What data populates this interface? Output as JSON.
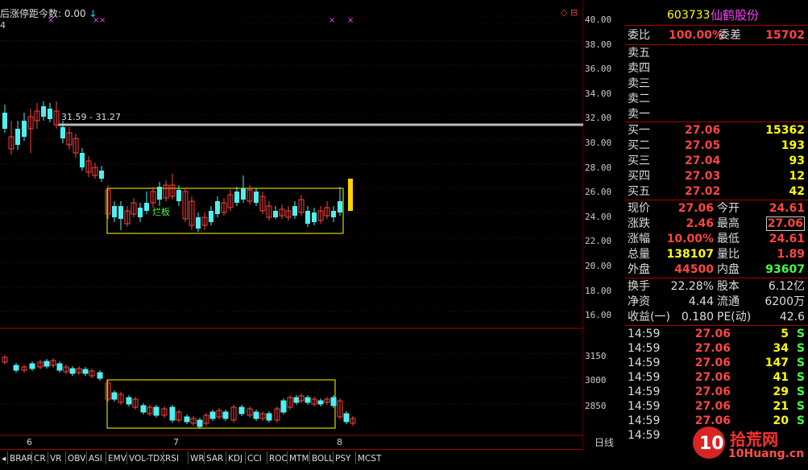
{
  "indicator": {
    "title": "后涨停距今数:",
    "value": "0.00",
    "arrow": "↓",
    "sub": "4"
  },
  "price_axis": [
    "40.00",
    "38.00",
    "36.00",
    "34.00",
    "32.00",
    "30.00",
    "28.00",
    "26.00",
    "24.00",
    "22.00",
    "20.00",
    "18.00",
    "16.00"
  ],
  "index_axis": [
    "3150",
    "3000",
    "2850"
  ],
  "x_axis": {
    "labels": [
      "6",
      "7",
      "8"
    ],
    "period": "日线"
  },
  "annotations": {
    "range_text": "31.59 - 31.27",
    "box_label": "烂板",
    "corner_icons": "◇ ⊟"
  },
  "tabs": [
    "BRAR",
    "CR",
    "VR",
    "OBV",
    "ASI",
    "EMV",
    "VOL-TDX",
    "RSI",
    "WR",
    "SAR",
    "KDJ",
    "CCI",
    "ROC",
    "MTM",
    "BOLL",
    "PSY",
    "MCST"
  ],
  "panel": {
    "code": "603733",
    "name": "仙鹤股份",
    "weibi_label": "委比",
    "weibi_value": "100.00%",
    "weicha_label": "委差",
    "weicha_value": "15702",
    "sell": [
      {
        "label": "卖五"
      },
      {
        "label": "卖四"
      },
      {
        "label": "卖三"
      },
      {
        "label": "卖二"
      },
      {
        "label": "卖一"
      }
    ],
    "buy": [
      {
        "label": "买一",
        "price": "27.06",
        "vol": "15362"
      },
      {
        "label": "买二",
        "price": "27.05",
        "vol": "193"
      },
      {
        "label": "买三",
        "price": "27.04",
        "vol": "93"
      },
      {
        "label": "买四",
        "price": "27.03",
        "vol": "12"
      },
      {
        "label": "买五",
        "price": "27.02",
        "vol": "42"
      }
    ],
    "quote": [
      {
        "l1": "现价",
        "v1": "27.06",
        "l2": "今开",
        "v2": "24.61",
        "c1": "red",
        "c2": "red"
      },
      {
        "l1": "涨跌",
        "v1": "2.46",
        "l2": "最高",
        "v2": "27.06",
        "c1": "red",
        "c2": "red"
      },
      {
        "l1": "涨幅",
        "v1": "10.00%",
        "l2": "最低",
        "v2": "24.61",
        "c1": "red",
        "c2": "red"
      },
      {
        "l1": "总量",
        "v1": "138107",
        "l2": "量比",
        "v2": "1.89",
        "c1": "yellow",
        "c2": "red"
      },
      {
        "l1": "外盘",
        "v1": "44500",
        "l2": "内盘",
        "v2": "93607",
        "c1": "red",
        "c2": "green"
      }
    ],
    "fund": [
      {
        "l1": "换手",
        "v1": "22.28%",
        "l2": "股本",
        "v2": "6.12亿"
      },
      {
        "l1": "净资",
        "v1": "4.44",
        "l2": "流通",
        "v2": "6200万"
      },
      {
        "l1": "收益(一)",
        "v1": "0.180",
        "l2": "PE(动)",
        "v2": "42.6"
      }
    ],
    "ticks": [
      {
        "time": "14:59",
        "price": "27.06",
        "vol": "5",
        "side": "S"
      },
      {
        "time": "14:59",
        "price": "27.06",
        "vol": "34",
        "side": "S"
      },
      {
        "time": "14:59",
        "price": "27.06",
        "vol": "147",
        "side": "S"
      },
      {
        "time": "14:59",
        "price": "27.06",
        "vol": "41",
        "side": "S"
      },
      {
        "time": "14:59",
        "price": "27.06",
        "vol": "29",
        "side": "S"
      },
      {
        "time": "14:59",
        "price": "27.06",
        "vol": "21",
        "side": "S"
      },
      {
        "time": "14:59",
        "price": "27.06",
        "vol": "20",
        "side": "S"
      },
      {
        "time": "14:59",
        "price": "",
        "vol": "",
        "side": ""
      }
    ]
  },
  "watermark": {
    "main": "拾荒网",
    "domain": "10Huang.cn"
  }
}
